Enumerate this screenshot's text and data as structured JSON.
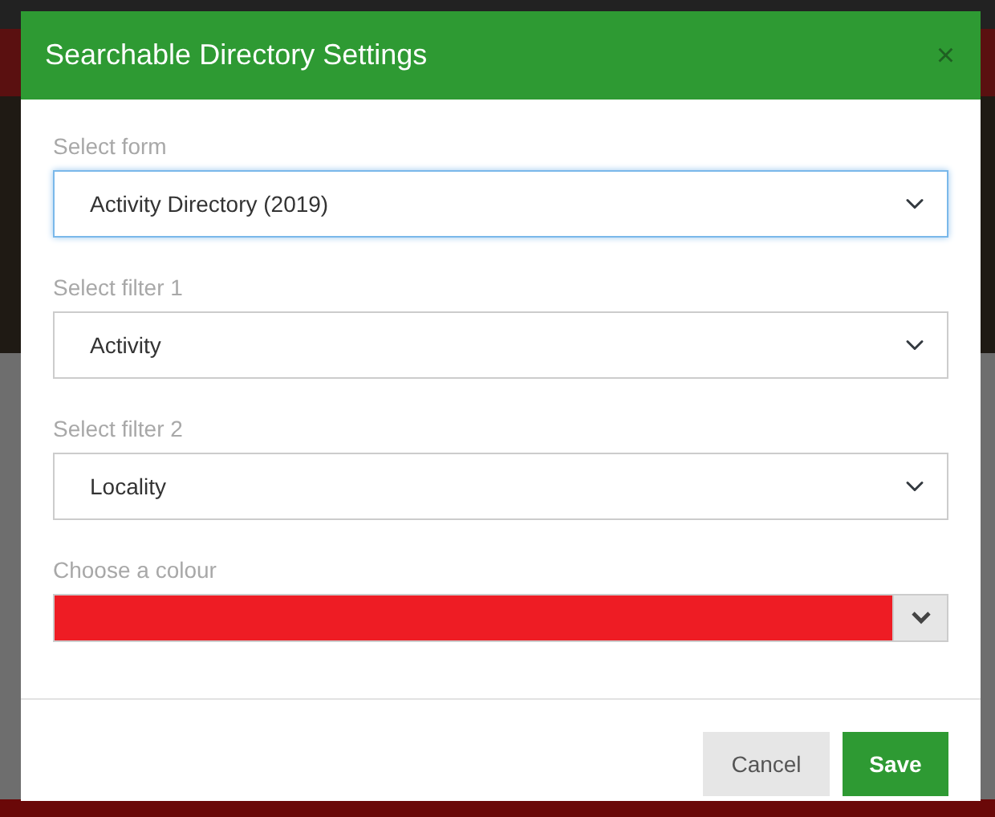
{
  "dialog": {
    "title": "Searchable Directory Settings",
    "close": "×",
    "fields": [
      {
        "kind": "select",
        "label": "Select form",
        "value": "Activity Directory (2019)",
        "focused": true
      },
      {
        "kind": "select",
        "label": "Select filter 1",
        "value": "Activity",
        "focused": false
      },
      {
        "kind": "select",
        "label": "Select filter 2",
        "value": "Locality",
        "focused": false
      },
      {
        "kind": "color",
        "label": "Choose a colour",
        "color": "#ee1c24"
      }
    ],
    "buttons": [
      {
        "label": "Cancel",
        "kind": "secondary"
      },
      {
        "label": "Save",
        "kind": "primary"
      }
    ]
  }
}
